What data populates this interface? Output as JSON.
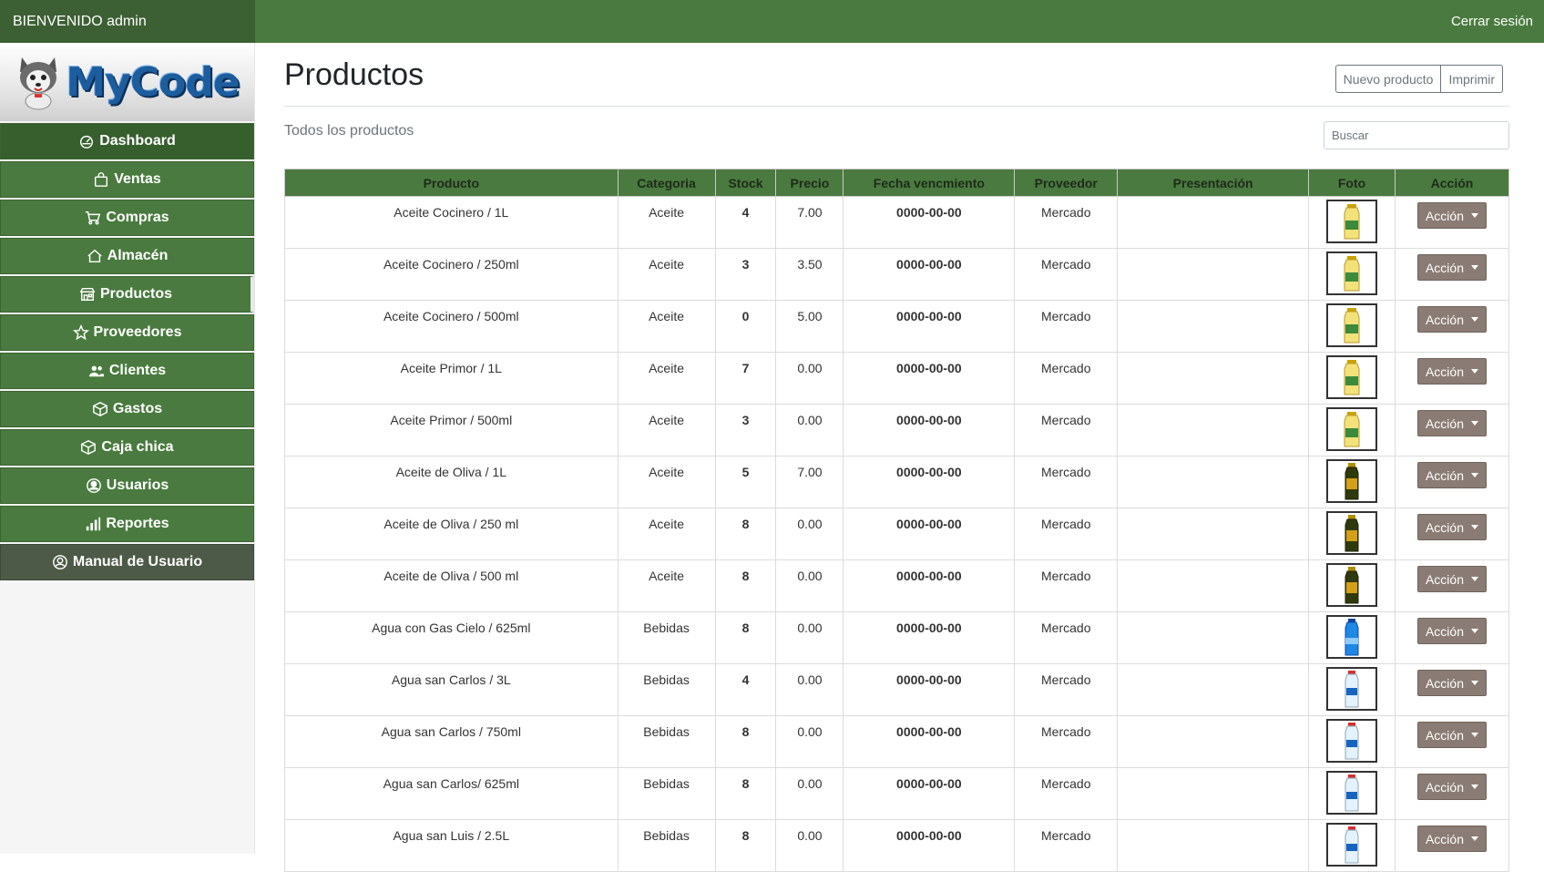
{
  "topbar": {
    "welcome": "BIENVENIDO admin",
    "logout": "Cerrar sesión"
  },
  "sidebar": {
    "logo_text": "MyCode",
    "items": [
      {
        "label": "Dashboard",
        "icon": "dashboard-icon"
      },
      {
        "label": "Ventas",
        "icon": "shopping-bag-icon"
      },
      {
        "label": "Compras",
        "icon": "cart-icon"
      },
      {
        "label": "Almacén",
        "icon": "house-icon"
      },
      {
        "label": "Productos",
        "icon": "shop-icon"
      },
      {
        "label": "Proveedores",
        "icon": "star-icon"
      },
      {
        "label": "Clientes",
        "icon": "people-icon"
      },
      {
        "label": "Gastos",
        "icon": "box-icon"
      },
      {
        "label": "Caja chica",
        "icon": "box-icon"
      },
      {
        "label": "Usuarios",
        "icon": "user-circle-icon"
      },
      {
        "label": "Reportes",
        "icon": "bar-chart-icon"
      },
      {
        "label": "Manual de Usuario",
        "icon": "user-circle-icon"
      }
    ]
  },
  "main": {
    "title": "Productos",
    "new_button": "Nuevo producto",
    "print_button": "Imprimir",
    "subtitle": "Todos los productos",
    "search_placeholder": "Buscar",
    "columns": [
      "Producto",
      "Categoria",
      "Stock",
      "Precio",
      "Fecha vencmiento",
      "Proveedor",
      "Presentación",
      "Foto",
      "Acción"
    ],
    "action_label": "Acción",
    "rows": [
      {
        "producto": "Aceite Cocinero / 1L",
        "categoria": "Aceite",
        "stock": "4",
        "precio": "7.00",
        "fecha": "0000-00-00",
        "proveedor": "Mercado",
        "presentacion": "",
        "foto": "yellow-bottle"
      },
      {
        "producto": "Aceite Cocinero / 250ml",
        "categoria": "Aceite",
        "stock": "3",
        "precio": "3.50",
        "fecha": "0000-00-00",
        "proveedor": "Mercado",
        "presentacion": "",
        "foto": "yellow-bottle"
      },
      {
        "producto": "Aceite Cocinero / 500ml",
        "categoria": "Aceite",
        "stock": "0",
        "precio": "5.00",
        "fecha": "0000-00-00",
        "proveedor": "Mercado",
        "presentacion": "",
        "foto": "yellow-bottle"
      },
      {
        "producto": "Aceite Primor / 1L",
        "categoria": "Aceite",
        "stock": "7",
        "precio": "0.00",
        "fecha": "0000-00-00",
        "proveedor": "Mercado",
        "presentacion": "",
        "foto": "yellow-bottle"
      },
      {
        "producto": "Aceite Primor / 500ml",
        "categoria": "Aceite",
        "stock": "3",
        "precio": "0.00",
        "fecha": "0000-00-00",
        "proveedor": "Mercado",
        "presentacion": "",
        "foto": "yellow-bottle"
      },
      {
        "producto": "Aceite de Oliva / 1L",
        "categoria": "Aceite",
        "stock": "5",
        "precio": "7.00",
        "fecha": "0000-00-00",
        "proveedor": "Mercado",
        "presentacion": "",
        "foto": "olive-bottle"
      },
      {
        "producto": "Aceite de Oliva / 250 ml",
        "categoria": "Aceite",
        "stock": "8",
        "precio": "0.00",
        "fecha": "0000-00-00",
        "proveedor": "Mercado",
        "presentacion": "",
        "foto": "olive-bottle"
      },
      {
        "producto": "Aceite de Oliva / 500 ml",
        "categoria": "Aceite",
        "stock": "8",
        "precio": "0.00",
        "fecha": "0000-00-00",
        "proveedor": "Mercado",
        "presentacion": "",
        "foto": "olive-bottle"
      },
      {
        "producto": "Agua con Gas Cielo / 625ml",
        "categoria": "Bebidas",
        "stock": "8",
        "precio": "0.00",
        "fecha": "0000-00-00",
        "proveedor": "Mercado",
        "presentacion": "",
        "foto": "blue-bottle"
      },
      {
        "producto": "Agua san Carlos / 3L",
        "categoria": "Bebidas",
        "stock": "4",
        "precio": "0.00",
        "fecha": "0000-00-00",
        "proveedor": "Mercado",
        "presentacion": "",
        "foto": "clear-bottle"
      },
      {
        "producto": "Agua san Carlos / 750ml",
        "categoria": "Bebidas",
        "stock": "8",
        "precio": "0.00",
        "fecha": "0000-00-00",
        "proveedor": "Mercado",
        "presentacion": "",
        "foto": "clear-bottle"
      },
      {
        "producto": "Agua san Carlos/ 625ml",
        "categoria": "Bebidas",
        "stock": "8",
        "precio": "0.00",
        "fecha": "0000-00-00",
        "proveedor": "Mercado",
        "presentacion": "",
        "foto": "clear-bottle"
      },
      {
        "producto": "Agua san Luis / 2.5L",
        "categoria": "Bebidas",
        "stock": "8",
        "precio": "0.00",
        "fecha": "0000-00-00",
        "proveedor": "Mercado",
        "presentacion": "",
        "foto": "clear-bottle"
      }
    ]
  },
  "colors": {
    "primary_green": "#4a7a3f",
    "dark_green": "#375f2e",
    "stock_blue": "#1a2fd1",
    "date_green": "#1a7a1a",
    "action_brown": "#8a7c74"
  }
}
